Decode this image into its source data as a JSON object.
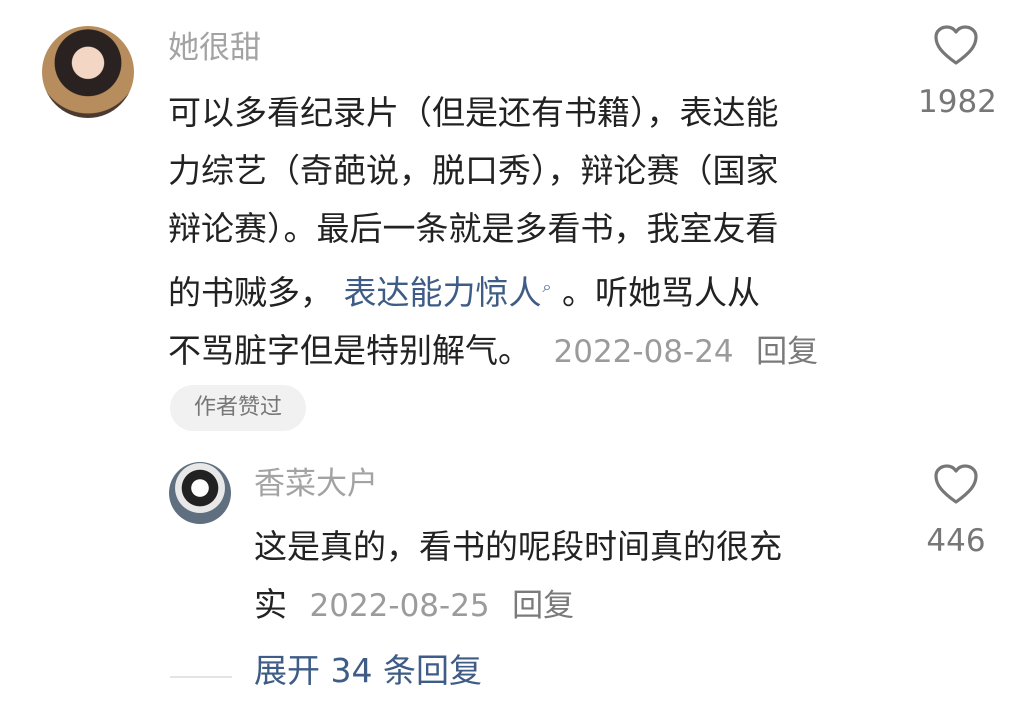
{
  "main_comment": {
    "username": "她很甜",
    "lines": [
      "可以多看纪录片（但是还有书籍），表达能",
      "力综艺（奇葩说，脱口秀），辩论赛（国家",
      "辩论赛）。最后一条就是多看书，我室友看",
      "的书贼多，",
      "表达能力惊人",
      "。听她骂人从",
      "不骂脏字但是特别解气。"
    ],
    "date": "2022-08-24",
    "reply_label": "回复",
    "like_count": "1982",
    "author_liked_label": "作者赞过",
    "icons": {
      "like": "heart-icon",
      "search": "search-icon"
    }
  },
  "reply_comment": {
    "username": "香菜大户",
    "lines": [
      "这是真的，看书的呢段时间真的很充",
      "实"
    ],
    "date": "2022-08-25",
    "reply_label": "回复",
    "like_count": "446",
    "icons": {
      "like": "heart-icon"
    }
  },
  "expand_replies": {
    "label": "展开 34 条回复"
  },
  "colors": {
    "primary_text": "#222222",
    "muted_text": "#9b9b9b",
    "link_text": "#3e5c86",
    "badge_bg": "#f1f1f1",
    "divider": "#e4e4e4"
  }
}
